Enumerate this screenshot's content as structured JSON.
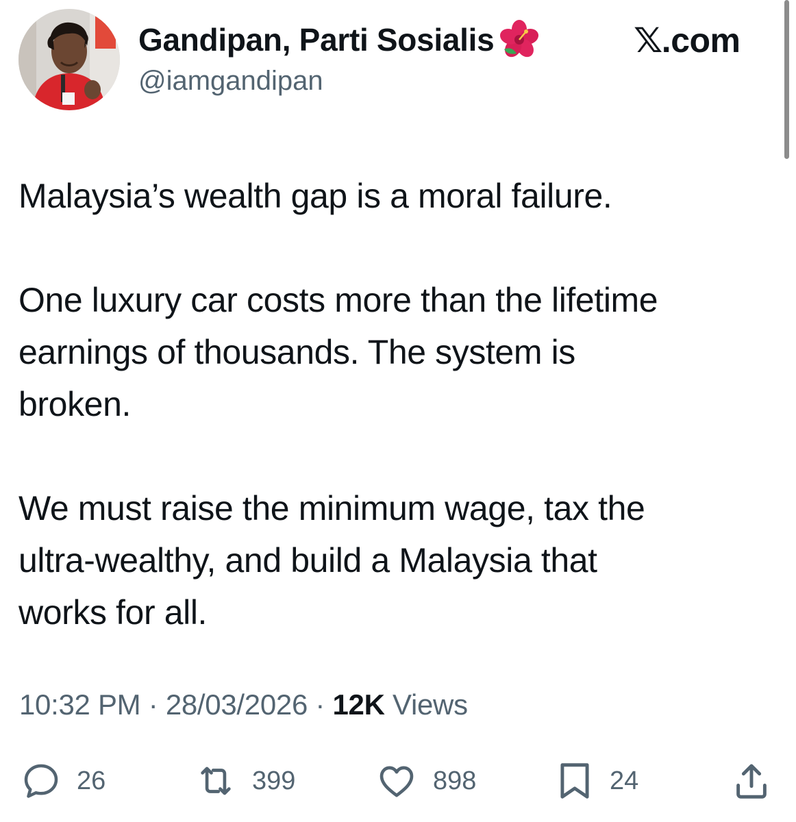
{
  "author": {
    "display_name": "Gandipan, Parti Sosialis",
    "handle": "@iamgandipan",
    "avatar_icon": "profile-photo",
    "name_emoji_icon": "hibiscus-icon"
  },
  "site_label": {
    "x_glyph": "𝕏",
    "suffix": ".com"
  },
  "tweet": {
    "paragraphs": [
      "Malaysia’s wealth gap is a moral failure.",
      "One luxury car costs more than the lifetime\nearnings of thousands. The system is\nbroken.",
      "We must raise the minimum wage, tax the\nultra-wealthy, and build a Malaysia that\nworks for all."
    ]
  },
  "meta": {
    "time": "10:32 PM",
    "separator": " · ",
    "date": "28/03/2026",
    "views_count": "12K",
    "views_label": " Views"
  },
  "actions": {
    "replies": {
      "icon": "reply-icon",
      "count": "26"
    },
    "reposts": {
      "icon": "repost-icon",
      "count": "399"
    },
    "likes": {
      "icon": "heart-icon",
      "count": "898"
    },
    "bookmarks": {
      "icon": "bookmark-icon",
      "count": "24"
    },
    "share": {
      "icon": "share-icon"
    }
  },
  "colors": {
    "text_primary": "#0f1419",
    "text_secondary": "#536471",
    "hibiscus": "#e0245e"
  }
}
